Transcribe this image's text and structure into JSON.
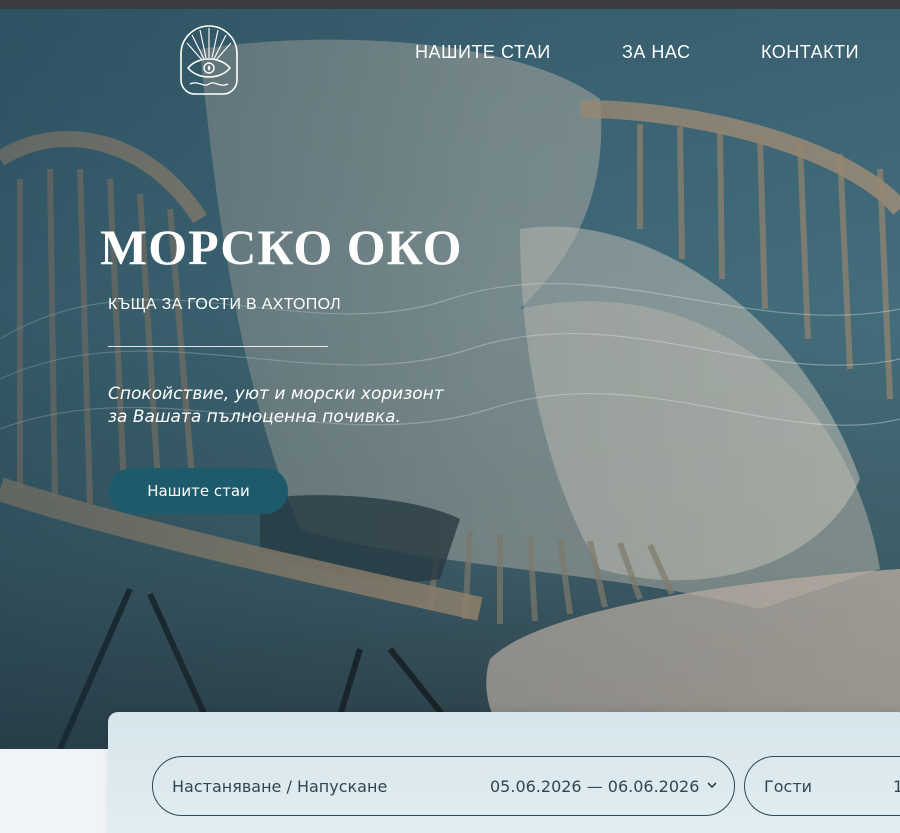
{
  "header": {
    "nav": [
      {
        "label": "НАШИТЕ СТАИ"
      },
      {
        "label": "ЗА НАС"
      },
      {
        "label": "КОНТАКТИ"
      }
    ]
  },
  "hero": {
    "title": "МОРСКО ОКО",
    "subtitle": "КЪЩА ЗА ГОСТИ В АХТОПОЛ",
    "tagline_line1": "Спокойствие, уют и морски хоризонт",
    "tagline_line2": "за Вашата пълноценна почивка.",
    "cta_label": "Нашите стаи"
  },
  "booking": {
    "dates_label": "Настаняване / Напускане",
    "dates_value": "05.06.2026 — 06.06.2026",
    "guests_label": "Гости",
    "guests_value": "1"
  },
  "colors": {
    "accent": "#1d5a6b",
    "hero_overlay": "#3c6474",
    "text_light": "#ffffff",
    "field_border": "#2c4a55"
  },
  "icons": {
    "logo": "eye-sun-arch-logo",
    "chevron": "chevron-down-icon"
  }
}
